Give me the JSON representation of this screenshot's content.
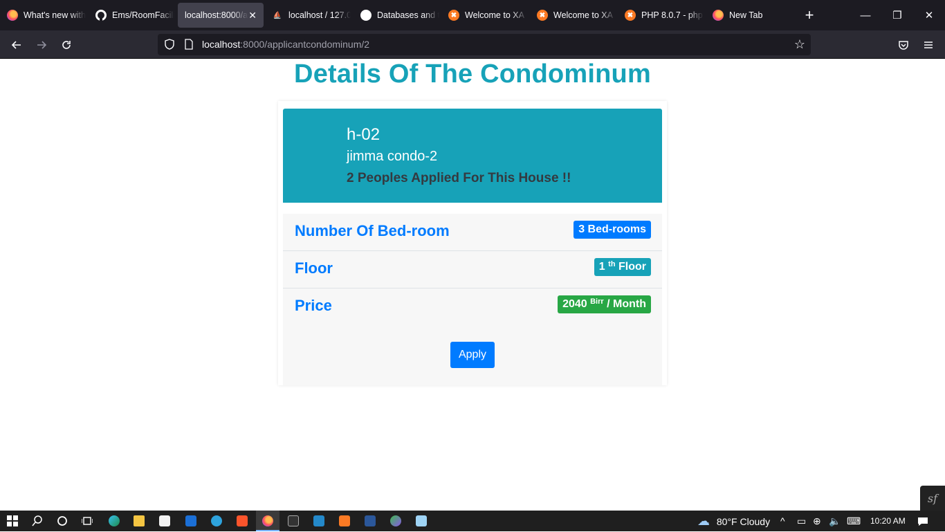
{
  "browser": {
    "tabs": [
      {
        "title": "What's new with",
        "favicon": "firefox-icon",
        "active": false
      },
      {
        "title": "Ems/RoomFacili",
        "favicon": "github-icon",
        "active": false
      },
      {
        "title": "localhost:8000/ap",
        "favicon": "none",
        "active": true
      },
      {
        "title": "localhost / 127.0",
        "favicon": "phpmyadmin-icon",
        "active": false
      },
      {
        "title": "Databases and t",
        "favicon": "symfony-icon",
        "active": false
      },
      {
        "title": "Welcome to XA",
        "favicon": "xampp-icon",
        "active": false
      },
      {
        "title": "Welcome to XA",
        "favicon": "xampp-icon",
        "active": false
      },
      {
        "title": "PHP 8.0.7 - php",
        "favicon": "xampp-icon",
        "active": false
      },
      {
        "title": "New Tab",
        "favicon": "firefox-icon",
        "active": false
      }
    ],
    "url_host": "localhost",
    "url_rest": ":8000/applicantcondominum/2"
  },
  "page": {
    "title": "Details Of The Condominum",
    "header": {
      "code": "h-02",
      "name": "jimma condo-2",
      "applied": "2 Peoples Applied For This House !!"
    },
    "rows": [
      {
        "label": "Number Of Bed-room",
        "badge": "3 Bed-rooms",
        "badge_color": "#007bff"
      },
      {
        "label": "Floor",
        "badge_pre": "1",
        "badge_sup": "th",
        "badge_post": "Floor",
        "badge_color": "#17a2b8"
      },
      {
        "label": "Price",
        "badge_pre": "2040",
        "badge_sup": "Birr",
        "badge_post": "/ Month",
        "badge_color": "#28a745"
      }
    ],
    "apply_label": "Apply",
    "accent": "#17a2b8"
  },
  "taskbar": {
    "weather": "80°F  Cloudy",
    "time": "10:20 AM"
  }
}
